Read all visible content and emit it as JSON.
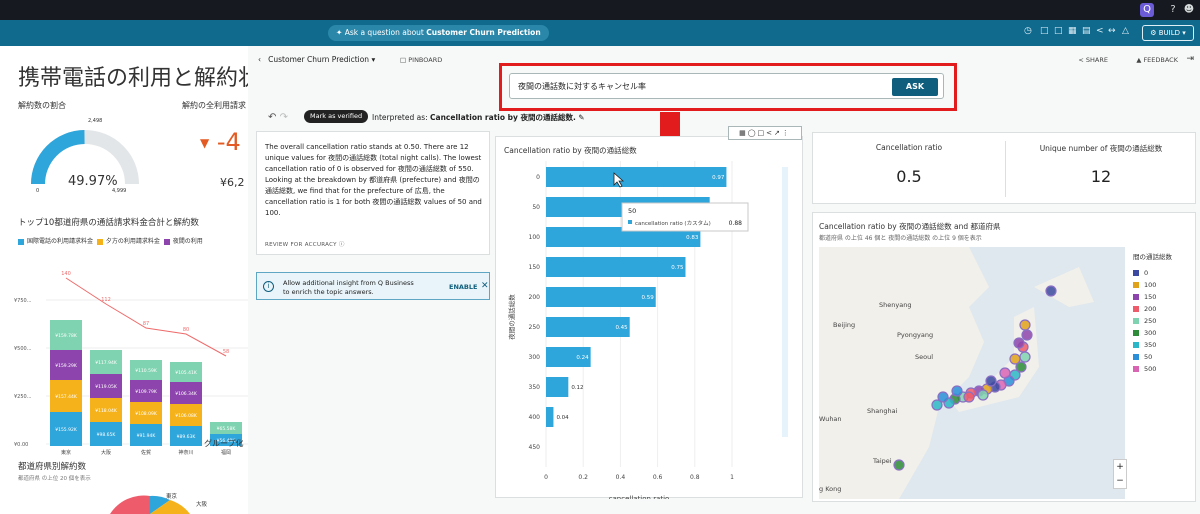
{
  "topbar": {
    "icons": [
      "amazon-q-icon",
      "help-icon",
      "user-icon"
    ]
  },
  "question_bar": {
    "prompt": "Ask a question about",
    "topic": "Customer Churn Prediction",
    "build_label": "BUILD"
  },
  "dashboard": {
    "title": "携帯電話の利用と解約状",
    "gauge_title": "解約数の割合",
    "gauge_value": "49.97%",
    "gauge_min": "0",
    "gauge_top": "2,498",
    "gauge_max": "4,999",
    "kpi_title": "解約の全利用請求",
    "kpi_value": "-4",
    "kpi_sub": "¥6,2",
    "bar_title": "トップ10都道府県の通話請求料金合計と解約数",
    "bar_legend": [
      "国際電話の利用請求料金",
      "夕方の利用請求料金",
      "夜間の利用"
    ],
    "bar_categories": [
      "東京",
      "大阪",
      "佐賀",
      "神奈川",
      "福岡"
    ],
    "bar_line_labels": [
      "140",
      "112",
      "87",
      "80",
      "58"
    ],
    "bar_top_labels": [
      "¥159.78K",
      "¥117.94K",
      "¥110.59K",
      "¥105.41K",
      "¥65.58K"
    ],
    "bar_mid_labels": [
      "¥159.29K",
      "¥119.05K",
      "¥109.79K",
      "¥106.34K",
      ""
    ],
    "bar_low_labels": [
      "¥157.44K",
      "¥118.04K",
      "¥108.09K",
      "¥106.08K",
      ""
    ],
    "bar_base_labels": [
      "¥155.92K",
      "¥98.65K",
      "¥91.94K",
      "¥89.63K",
      "¥56.49K"
    ],
    "bar_axis": [
      "¥750...",
      "¥500...",
      "¥250...",
      "¥0.00"
    ],
    "group_label": "グループ化",
    "pie_title": "都道府県別解約数",
    "pie_sub": "都道府県 の上位 20 個を表示",
    "pie_labels": [
      "東京",
      "大阪"
    ]
  },
  "panel": {
    "breadcrumb": "Customer Churn Prediction",
    "pinboard": "PINBOARD",
    "share": "SHARE",
    "feedback": "FEEDBACK",
    "query_text": "夜間の通話数に対するキャンセル率",
    "ask_label": "ASK",
    "verified_label": "Mark as verified",
    "interpreted_prefix": "Interpreted as:",
    "interpreted_value": "Cancellation ratio by 夜間の通話総数.",
    "summary_text": "The overall cancellation ratio stands at 0.50. There are 12 unique values for 夜間の通話総数 (total night calls). The lowest cancellation ratio of 0 is observed for 夜間の通話総数 of 550. Looking at the breakdown by 都道府県 (prefecture) and 夜間の通話総数, we find that for the prefecture of 広島, the cancellation ratio is 1 for both 夜間の通話総数 values of 50 and 100.",
    "review_label": "REVIEW FOR ACCURACY",
    "qbiz_text_1": "Allow additional insight from Q Business",
    "qbiz_text_2": "to enrich the topic answers.",
    "enable_label": "ENABLE"
  },
  "bar_chart": {
    "title": "Cancellation ratio by 夜間の通話総数",
    "xlabel": "cancellation ratio",
    "ylabel": "夜間の通話総数",
    "tooltip_category": "50",
    "tooltip_series": "cancellation ratio (カスタム)",
    "tooltip_value": "0.88"
  },
  "chart_data": {
    "type": "bar",
    "orientation": "horizontal",
    "categories": [
      "0",
      "50",
      "100",
      "150",
      "200",
      "250",
      "300",
      "350",
      "400",
      "450"
    ],
    "values": [
      0.97,
      0.88,
      0.83,
      0.75,
      0.59,
      0.45,
      0.24,
      0.12,
      0.04,
      null
    ],
    "value_labels": [
      "0.97",
      "0.88",
      "0.83",
      "0.75",
      "0.59",
      "0.45",
      "0.24",
      "0.12",
      "0.04",
      ""
    ],
    "x_ticks": [
      "0",
      "0.2",
      "0.4",
      "0.6",
      "0.8",
      "1"
    ],
    "xlim": [
      0,
      1
    ],
    "color": "#2ea5db"
  },
  "kpis": [
    {
      "label": "Cancellation ratio",
      "value": "0.5"
    },
    {
      "label": "Unique number of 夜間の通話総数",
      "value": "12"
    }
  ],
  "map_card": {
    "title": "Cancellation ratio by 夜間の通話総数 and 都道府県",
    "subtitle": "都道府県 の上位 46 個と 夜間の通話総数 の上位 9 個を表示",
    "legend_title": "間の通話総数",
    "legend": [
      {
        "label": "0",
        "color": "#3b4aa0"
      },
      {
        "label": "100",
        "color": "#e0a21b"
      },
      {
        "label": "150",
        "color": "#8e44ad"
      },
      {
        "label": "200",
        "color": "#ee5c6b"
      },
      {
        "label": "250",
        "color": "#7fd3b0"
      },
      {
        "label": "300",
        "color": "#2e8b3a"
      },
      {
        "label": "350",
        "color": "#2bb7c7"
      },
      {
        "label": "50",
        "color": "#2a8fd8"
      },
      {
        "label": "500",
        "color": "#d964b4"
      }
    ],
    "places": [
      "Shenyang",
      "Beijing",
      "Pyongyang",
      "Seoul",
      "Shanghai",
      "Wuhan",
      "Taipei",
      "g Kong"
    ]
  }
}
